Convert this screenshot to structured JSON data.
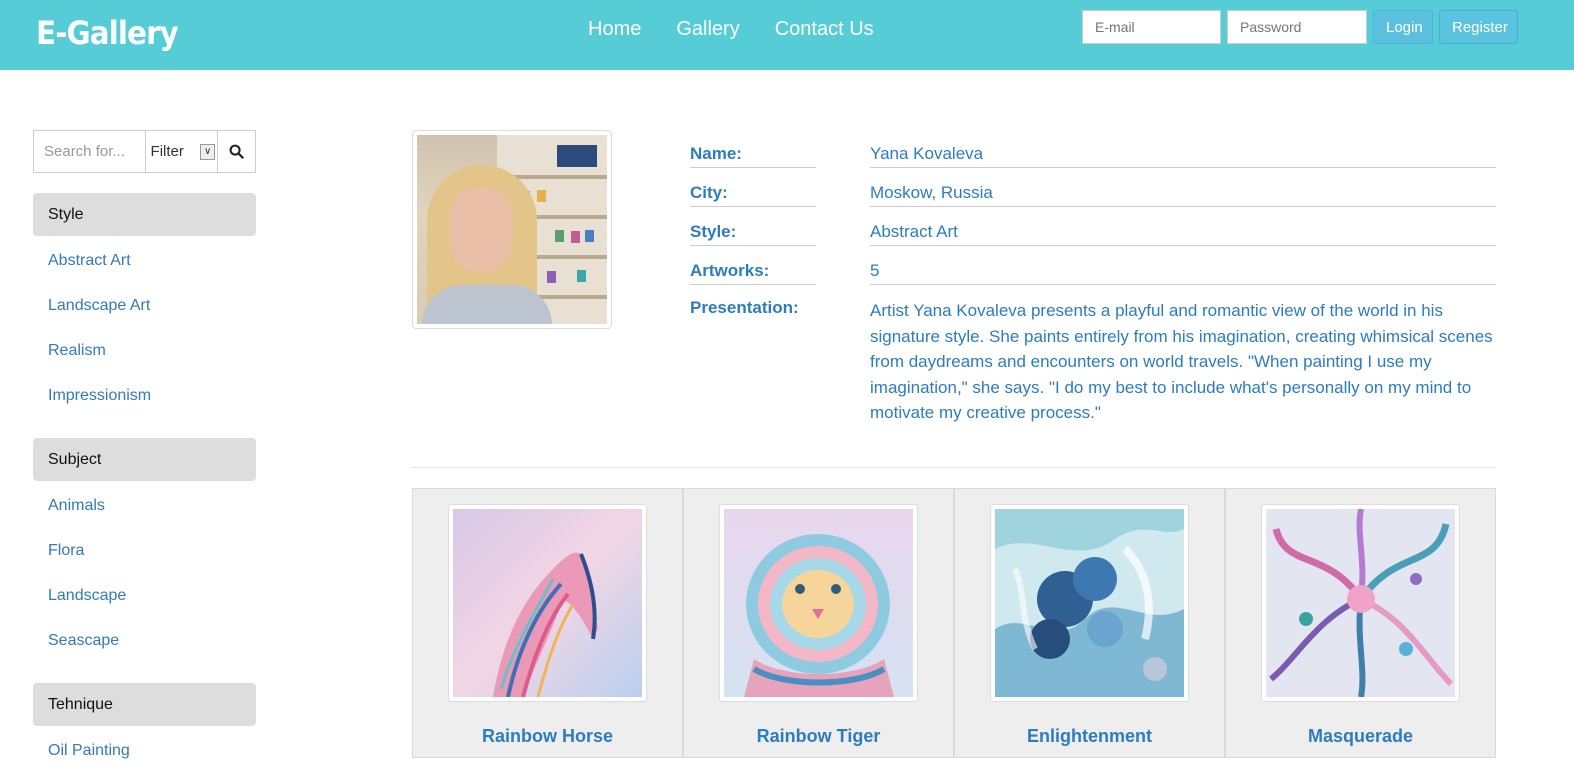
{
  "header": {
    "brand": "E-Gallery",
    "nav": [
      "Home",
      "Gallery",
      "Contact Us"
    ],
    "email_placeholder": "E-mail",
    "password_placeholder": "Password",
    "login_label": "Login",
    "register_label": "Register"
  },
  "sidebar": {
    "search_placeholder": "Search for...",
    "filter_value": "Filter",
    "groups": [
      {
        "title": "Style",
        "items": [
          "Abstract Art",
          "Landscape Art",
          "Realism",
          "Impressionism"
        ]
      },
      {
        "title": "Subject",
        "items": [
          "Animals",
          "Flora",
          "Landscape",
          "Seascape"
        ]
      },
      {
        "title": "Tehnique",
        "items": [
          "Oil Painting"
        ]
      }
    ]
  },
  "artist": {
    "name_label": "Name:",
    "name": "Yana Kovaleva",
    "city_label": "City:",
    "city": "Moskow, Russia",
    "style_label": "Style:",
    "style": "Abstract Art",
    "artworks_label": "Artworks:",
    "artworks": "5",
    "presentation_label": "Presentation:",
    "presentation": "Artist Yana Kovaleva presents a playful and romantic view of the world in his signature style. She paints entirely from his imagination, creating whimsical scenes from daydreams and encounters on world travels. \"When painting I use my imagination,\" she says. \"I do my best to include what's personally on my mind to motivate my creative process.\""
  },
  "artworks": [
    {
      "title": "Rainbow Horse"
    },
    {
      "title": "Rainbow Tiger"
    },
    {
      "title": "Enlightenment"
    },
    {
      "title": "Masquerade"
    }
  ],
  "colors": {
    "header_bg": "#55ccd6",
    "link": "#337ab7",
    "label": "#2c7cc0",
    "button": "#5bc0de"
  }
}
